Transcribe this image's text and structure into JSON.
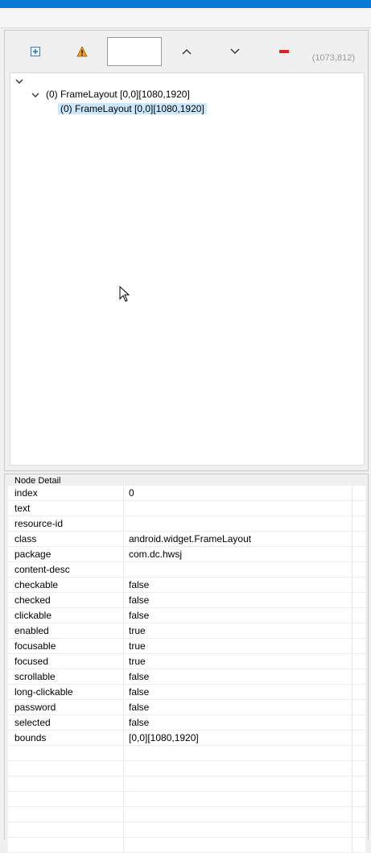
{
  "toolbar": {
    "coords": "(1073,812)",
    "search_value": ""
  },
  "tree": {
    "root_label": "(0) FrameLayout [0,0][1080,1920]",
    "child_label": "(0) FrameLayout [0,0][1080,1920]"
  },
  "details": {
    "title": "Node Detail",
    "rows": [
      {
        "name": "index",
        "value": "0"
      },
      {
        "name": "text",
        "value": ""
      },
      {
        "name": "resource-id",
        "value": ""
      },
      {
        "name": "class",
        "value": "android.widget.FrameLayout"
      },
      {
        "name": "package",
        "value": "com.dc.hwsj"
      },
      {
        "name": "content-desc",
        "value": ""
      },
      {
        "name": "checkable",
        "value": "false"
      },
      {
        "name": "checked",
        "value": "false"
      },
      {
        "name": "clickable",
        "value": "false"
      },
      {
        "name": "enabled",
        "value": "true"
      },
      {
        "name": "focusable",
        "value": "true"
      },
      {
        "name": "focused",
        "value": "true"
      },
      {
        "name": "scrollable",
        "value": "false"
      },
      {
        "name": "long-clickable",
        "value": "false"
      },
      {
        "name": "password",
        "value": "false"
      },
      {
        "name": "selected",
        "value": "false"
      },
      {
        "name": "bounds",
        "value": "[0,0][1080,1920]"
      }
    ]
  },
  "colors": {
    "accent": "#0a79d6",
    "selection": "#cce8ff",
    "warning": "#f0a020",
    "remove": "#e02020"
  }
}
